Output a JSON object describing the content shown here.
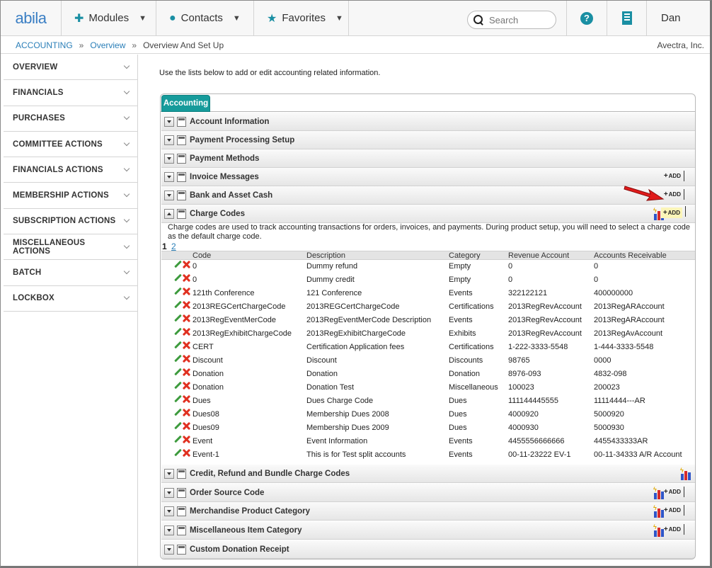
{
  "app": {
    "logo": "abila",
    "nav": {
      "modules": "Modules",
      "contacts": "Contacts",
      "favorites": "Favorites",
      "search_placeholder": "Search",
      "help": "?",
      "user": "Dan"
    }
  },
  "breadcrumb": {
    "items": [
      "ACCOUNTING",
      "Overview"
    ],
    "current": "Overview And Set Up",
    "separator": "»",
    "organization": "Avectra, Inc."
  },
  "sidebar": {
    "items": [
      "OVERVIEW",
      "FINANCIALS",
      "PURCHASES",
      "COMMITTEE ACTIONS",
      "FINANCIALS ACTIONS",
      "MEMBERSHIP ACTIONS",
      "SUBSCRIPTION ACTIONS",
      "MISCELLANEOUS ACTIONS",
      "BATCH",
      "LOCKBOX"
    ]
  },
  "main": {
    "intro": "Use the lists below to add or edit accounting related information.",
    "tab": "Accounting",
    "add_label": "ADD",
    "sections_top": [
      "Account Information",
      "Payment Processing Setup",
      "Payment Methods",
      "Invoice Messages",
      "Bank and Asset Cash"
    ],
    "charge_codes": {
      "title": "Charge Codes",
      "description": "Charge codes are used to track accounting transactions for orders, invoices, and payments. During product setup, you will need to select a charge code as the default charge code.",
      "pages": [
        "1",
        "2"
      ],
      "columns": [
        "Code",
        "Description",
        "Category",
        "Revenue Account",
        "Accounts Receivable"
      ],
      "rows": [
        [
          "0",
          "Dummy refund",
          "Empty",
          "0",
          "0"
        ],
        [
          "0",
          "Dummy credit",
          "Empty",
          "0",
          "0"
        ],
        [
          "121th Conference",
          "121 Conference",
          "Events",
          "322122121",
          "400000000"
        ],
        [
          "2013REGCertChargeCode",
          "2013REGCertChargeCode",
          "Certifications",
          "2013RegRevAccount",
          "2013RegARAccount"
        ],
        [
          "2013RegEventMerCode",
          "2013RegEventMerCode Description",
          "Events",
          "2013RegRevAccount",
          "2013RegARAccount"
        ],
        [
          "2013RegExhibitChargeCode",
          "2013RegExhibitChargeCode",
          "Exhibits",
          "2013RegRevAccount",
          "2013RegAvAccount"
        ],
        [
          "CERT",
          "Certification Application fees",
          "Certifications",
          "1-222-3333-5548",
          "1-444-3333-5548"
        ],
        [
          "Discount",
          "Discount",
          "Discounts",
          "98765",
          "0000"
        ],
        [
          "Donation",
          "Donation",
          "Donation",
          "8976-093",
          "4832-098"
        ],
        [
          "Donation",
          "Donation Test",
          "Miscellaneous",
          "100023",
          "200023"
        ],
        [
          "Dues",
          "Dues Charge Code",
          "Dues",
          "111144445555",
          "11114444---AR"
        ],
        [
          "Dues08",
          "Membership Dues 2008",
          "Dues",
          "4000920",
          "5000920"
        ],
        [
          "Dues09",
          "Membership Dues 2009",
          "Dues",
          "4000930",
          "5000930"
        ],
        [
          "Event",
          "Event Information",
          "Events",
          "4455556666666",
          "4455433333AR"
        ],
        [
          "Event-1",
          "This is for Test split accounts",
          "Events",
          "00-11-23222 EV-1",
          "00-11-34333 A/R Account"
        ]
      ]
    },
    "sections_bottom": [
      "Credit, Refund and Bundle Charge Codes",
      "Order Source Code",
      "Merchandise Product Category",
      "Miscellaneous Item Category",
      "Custom Donation Receipt"
    ]
  },
  "colors": {
    "accent": "#169b9b",
    "link": "#2b7fb8",
    "edit": "#3e9b3e",
    "delete": "#e03020",
    "pointer_arrow": "#e01b1b"
  }
}
